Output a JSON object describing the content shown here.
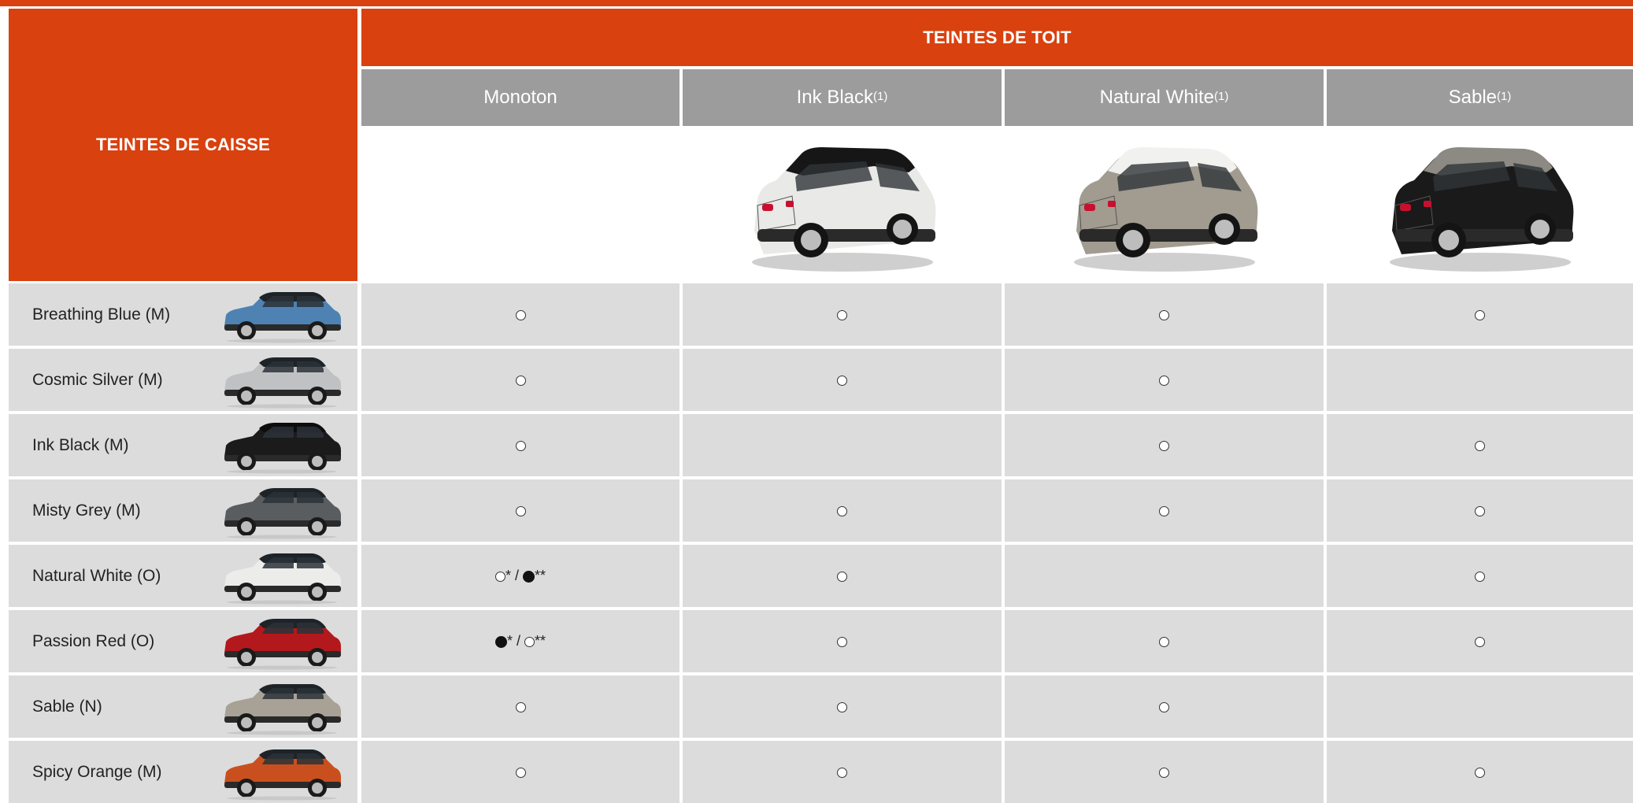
{
  "headers": {
    "body_colors": "TEINTES DE CAISSE",
    "roof_colors": "TEINTES DE TOIT"
  },
  "roof_columns": [
    {
      "label": "Monoton",
      "note": "",
      "car_body": "",
      "car_roof": ""
    },
    {
      "label": "Ink Black",
      "note": "(1)",
      "car_body": "#e9e9e7",
      "car_roof": "#161616"
    },
    {
      "label": "Natural White",
      "note": "(1)",
      "car_body": "#a29b90",
      "car_roof": "#f1f1ef"
    },
    {
      "label": "Sable",
      "note": "(1)",
      "car_body": "#1a1a1a",
      "car_roof": "#8d8a84"
    }
  ],
  "body_rows": [
    {
      "name": "Breathing Blue (M)",
      "color": "#4e82b3",
      "roof": "#1d2327",
      "cells": [
        "open",
        "open",
        "open",
        "open"
      ]
    },
    {
      "name": "Cosmic Silver (M)",
      "color": "#bfc1c2",
      "roof": "#1d2327",
      "cells": [
        "open",
        "open",
        "open",
        ""
      ]
    },
    {
      "name": "Ink Black (M)",
      "color": "#1b1b1b",
      "roof": "#0d0d0d",
      "cells": [
        "open",
        "",
        "open",
        "open"
      ]
    },
    {
      "name": "Misty Grey (M)",
      "color": "#5a5d60",
      "roof": "#1d2327",
      "cells": [
        "open",
        "open",
        "open",
        "open"
      ]
    },
    {
      "name": "Natural White (O)",
      "color": "#ececea",
      "roof": "#1d2327",
      "cells": [
        "open* / fill**",
        "open",
        "",
        "open"
      ]
    },
    {
      "name": "Passion Red (O)",
      "color": "#b3191c",
      "roof": "#1d2327",
      "cells": [
        "fill* / open**",
        "open",
        "open",
        "open"
      ]
    },
    {
      "name": "Sable (N)",
      "color": "#a8a196",
      "roof": "#1d2327",
      "cells": [
        "open",
        "open",
        "open",
        ""
      ]
    },
    {
      "name": "Spicy Orange (M)",
      "color": "#c9501e",
      "roof": "#1d2327",
      "cells": [
        "open",
        "open",
        "open",
        "open"
      ]
    }
  ],
  "icons": {
    "available": "circle-open-icon",
    "standard": "circle-filled-icon"
  },
  "colors": {
    "accent": "#d9410f",
    "header_grey": "#9b9c9b",
    "cell_grey": "#dcdcdd"
  }
}
